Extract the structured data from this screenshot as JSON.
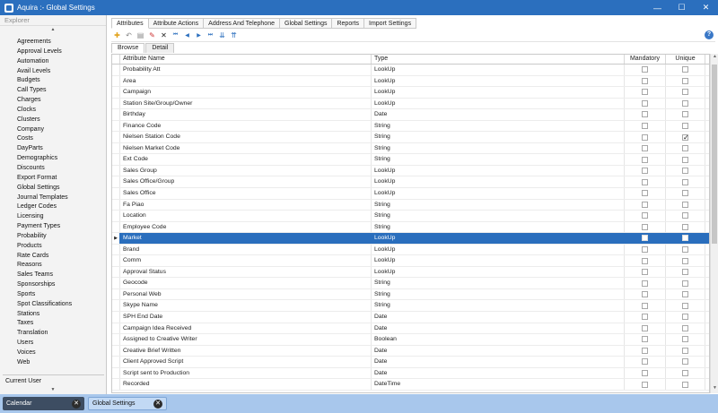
{
  "window": {
    "title": "Aquira :- Global Settings",
    "minimize": "—",
    "maximize": "☐",
    "close": "✕"
  },
  "explorer": {
    "header": "Explorer",
    "items": [
      "Agreements",
      "Approval Levels",
      "Automation",
      "Avail Levels",
      "Budgets",
      "Call Types",
      "Charges",
      "Clocks",
      "Clusters",
      "Company",
      "Costs",
      "DayParts",
      "Demographics",
      "Discounts",
      "Export Format",
      "Global Settings",
      "Journal Templates",
      "Ledger Codes",
      "Licensing",
      "Payment Types",
      "Probability",
      "Products",
      "Rate Cards",
      "Reasons",
      "Sales Teams",
      "Sponsorships",
      "Sports",
      "Spot Classifications",
      "Stations",
      "Taxes",
      "Translation",
      "Users",
      "Voices",
      "Web"
    ],
    "current_user": "Current User",
    "scroll_up": "▲",
    "scroll_down": "▼"
  },
  "tabs": [
    "Attributes",
    "Attribute Actions",
    "Address And Telephone",
    "Global Settings",
    "Reports",
    "Import Settings"
  ],
  "active_tab": "Attributes",
  "toolbar": {
    "new": "✚",
    "undo": "↶",
    "save": "▤",
    "edit": "✎",
    "delete": "✕",
    "first": "⏮",
    "prev": "◀",
    "next": "▶",
    "last": "⏭",
    "expand": "⇊",
    "collapse": "⇈",
    "help": "?"
  },
  "subtabs": [
    "Browse",
    "Detail"
  ],
  "active_subtab": "Browse",
  "grid": {
    "columns": {
      "name": "Attribute Name",
      "type": "Type",
      "mandatory": "Mandatory",
      "unique": "Unique"
    },
    "selected_indicator": "▶",
    "rows": [
      {
        "name": "Probability Att",
        "type": "LookUp",
        "mandatory": false,
        "unique": false
      },
      {
        "name": "Area",
        "type": "LookUp",
        "mandatory": false,
        "unique": false
      },
      {
        "name": "Campaign",
        "type": "LookUp",
        "mandatory": false,
        "unique": false
      },
      {
        "name": "Station Site/Group/Owner",
        "type": "LookUp",
        "mandatory": false,
        "unique": false
      },
      {
        "name": "Birthday",
        "type": "Date",
        "mandatory": false,
        "unique": false
      },
      {
        "name": "Finance Code",
        "type": "String",
        "mandatory": false,
        "unique": false
      },
      {
        "name": "Nielsen Station Code",
        "type": "String",
        "mandatory": false,
        "unique": true
      },
      {
        "name": "Nielsen Market Code",
        "type": "String",
        "mandatory": false,
        "unique": false
      },
      {
        "name": "Ext Code",
        "type": "String",
        "mandatory": false,
        "unique": false
      },
      {
        "name": "Sales Group",
        "type": "LookUp",
        "mandatory": false,
        "unique": false
      },
      {
        "name": "Sales Office/Group",
        "type": "LookUp",
        "mandatory": false,
        "unique": false
      },
      {
        "name": "Sales Office",
        "type": "LookUp",
        "mandatory": false,
        "unique": false
      },
      {
        "name": "Fa Piao",
        "type": "String",
        "mandatory": false,
        "unique": false
      },
      {
        "name": "Location",
        "type": "String",
        "mandatory": false,
        "unique": false
      },
      {
        "name": "Employee Code",
        "type": "String",
        "mandatory": false,
        "unique": false
      },
      {
        "name": "Market",
        "type": "LookUp",
        "mandatory": false,
        "unique": false,
        "selected": true
      },
      {
        "name": "Brand",
        "type": "LookUp",
        "mandatory": false,
        "unique": false
      },
      {
        "name": "Comm",
        "type": "LookUp",
        "mandatory": false,
        "unique": false
      },
      {
        "name": "Approval Status",
        "type": "LookUp",
        "mandatory": false,
        "unique": false
      },
      {
        "name": "Geocode",
        "type": "String",
        "mandatory": false,
        "unique": false
      },
      {
        "name": "Personal Web",
        "type": "String",
        "mandatory": false,
        "unique": false
      },
      {
        "name": "Skype Name",
        "type": "String",
        "mandatory": false,
        "unique": false
      },
      {
        "name": "SPH End Date",
        "type": "Date",
        "mandatory": false,
        "unique": false
      },
      {
        "name": "Campaign Idea Received",
        "type": "Date",
        "mandatory": false,
        "unique": false
      },
      {
        "name": "Assigned to Creative Writer",
        "type": "Boolean",
        "mandatory": false,
        "unique": false
      },
      {
        "name": "Creative Brief Written",
        "type": "Date",
        "mandatory": false,
        "unique": false
      },
      {
        "name": "Client Approved Script",
        "type": "Date",
        "mandatory": false,
        "unique": false
      },
      {
        "name": "Script sent to Production",
        "type": "Date",
        "mandatory": false,
        "unique": false
      },
      {
        "name": "Recorded",
        "type": "DateTime",
        "mandatory": false,
        "unique": false
      }
    ]
  },
  "taskbar": [
    {
      "label": "Calendar",
      "close": "✕"
    },
    {
      "label": "Global Settings",
      "close": "✕"
    }
  ],
  "colors": {
    "titlebar": "#2b6fbe",
    "selection": "#2a6ebd",
    "taskbar": "#a8c7ec"
  }
}
